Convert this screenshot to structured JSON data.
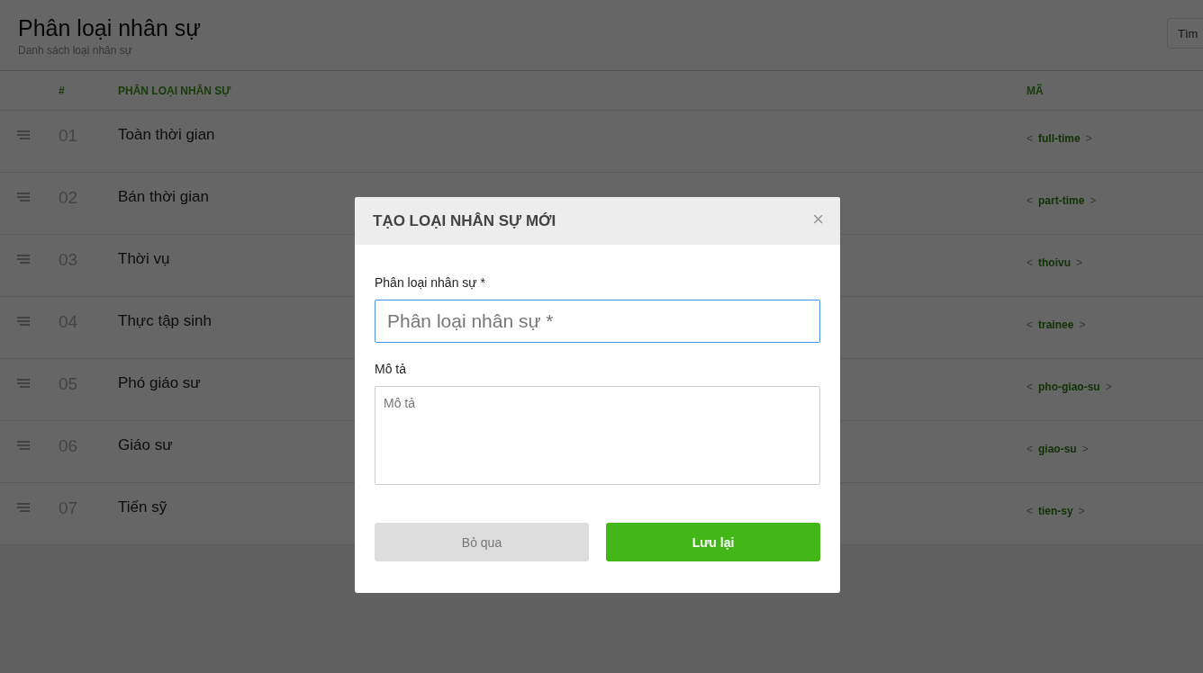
{
  "page": {
    "title": "Phân loại nhân sự",
    "subtitle": "Danh sách loại nhân sự",
    "search": {
      "placeholder": "Tìm"
    }
  },
  "table": {
    "columns": [
      "#",
      "PHÂN LOẠI NHÂN SỰ",
      "MÃ"
    ],
    "rows": [
      {
        "number": "01",
        "name": "Toàn thời gian",
        "bracket_open": "<",
        "code": "full-time",
        "bracket_close": ">"
      },
      {
        "number": "02",
        "name": "Bán thời gian",
        "bracket_open": "<",
        "code": "part-time",
        "bracket_close": ">"
      },
      {
        "number": "03",
        "name": "Thời vụ",
        "bracket_open": "<",
        "code": "thoivu",
        "bracket_close": ">"
      },
      {
        "number": "04",
        "name": "Thực tập sinh",
        "bracket_open": "<",
        "code": "trainee",
        "bracket_close": ">"
      },
      {
        "number": "05",
        "name": "Phó giáo sư",
        "bracket_open": "<",
        "code": "pho-giao-su",
        "bracket_close": ">"
      },
      {
        "number": "06",
        "name": "Giáo sư",
        "bracket_open": "<",
        "code": "giao-su",
        "bracket_close": ">"
      },
      {
        "number": "07",
        "name": "Tiến sỹ",
        "bracket_open": "<",
        "code": "tien-sy",
        "bracket_close": ">"
      }
    ]
  },
  "dialog": {
    "title": "TẠO LOẠI NHÂN SỰ MỚI",
    "close": "×",
    "fields": [
      {
        "kind": "input",
        "label": "Phân loại nhân sự *",
        "placeholder": "Phân loại nhân sự *",
        "focused": true
      },
      {
        "kind": "textarea",
        "label": "Mô tả",
        "placeholder": "Mô tả",
        "focused": false
      }
    ],
    "buttons": [
      {
        "label": "Bỏ qua",
        "kind": "secondary"
      },
      {
        "label": "Lưu lại",
        "kind": "primary"
      }
    ]
  }
}
